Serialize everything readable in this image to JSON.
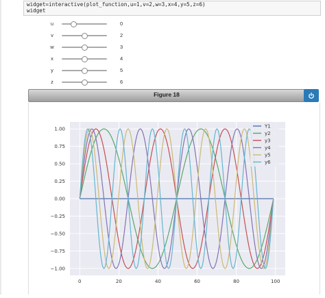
{
  "code": {
    "line1_prefix": "widget=interactive(plot_function,u=",
    "line1_values": [
      {
        "name": "u",
        "value": "1"
      },
      {
        "name": "v",
        "value": "2"
      },
      {
        "name": "w",
        "value": "3"
      },
      {
        "name": "x",
        "value": "4"
      },
      {
        "name": "y",
        "value": "5"
      },
      {
        "name": "z",
        "value": "6"
      }
    ],
    "line1_full": "widget=interactive(plot_function,u=1,v=2,w=3,x=4,y=5,z=6)",
    "line2": "widget"
  },
  "sliders": [
    {
      "label": "u",
      "value": "0",
      "fraction": 0.25
    },
    {
      "label": "v",
      "value": "2",
      "fraction": 0.5
    },
    {
      "label": "w",
      "value": "3",
      "fraction": 0.5
    },
    {
      "label": "x",
      "value": "4",
      "fraction": 0.5
    },
    {
      "label": "y",
      "value": "5",
      "fraction": 0.5
    },
    {
      "label": "z",
      "value": "6",
      "fraction": 0.5
    }
  ],
  "figure": {
    "title": "Figure 18",
    "power_icon": "power-icon"
  },
  "colors": {
    "accent": "#2a7ab8",
    "plot_bg": "#eaeaf2"
  },
  "chart_data": {
    "type": "line",
    "xlim": [
      -5,
      105
    ],
    "ylim": [
      -1.1,
      1.1
    ],
    "xticks": [
      0,
      20,
      40,
      60,
      80,
      100
    ],
    "yticks": [
      1.0,
      0.75,
      0.5,
      0.25,
      0.0,
      -0.25,
      -0.5,
      -0.75,
      -1.0
    ],
    "ytick_labels": [
      "1.00",
      "0.75",
      "0.50",
      "0.25",
      "0.00",
      "−0.25",
      "−0.50",
      "−0.75",
      "−1.00"
    ],
    "xtick_labels": [
      "0",
      "20",
      "40",
      "60",
      "80",
      "100"
    ],
    "x_range": [
      0,
      99
    ],
    "grid": true,
    "legend_position": "top-right",
    "series": [
      {
        "name": "Y1",
        "color": "#4c72b0",
        "frequency": 0
      },
      {
        "name": "y2",
        "color": "#55a868",
        "frequency": 2
      },
      {
        "name": "y3",
        "color": "#c44e52",
        "frequency": 3
      },
      {
        "name": "y4",
        "color": "#8172b2",
        "frequency": 4
      },
      {
        "name": "y5",
        "color": "#ccb974",
        "frequency": 5
      },
      {
        "name": "y6",
        "color": "#64b5cd",
        "frequency": 6
      }
    ]
  }
}
